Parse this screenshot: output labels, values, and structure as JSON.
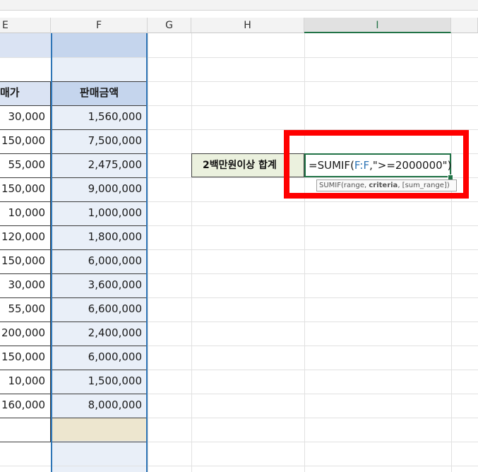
{
  "columns": [
    "E",
    "F",
    "G",
    "H",
    "I",
    "J"
  ],
  "headers": {
    "e": "매가",
    "f": "판매금액"
  },
  "rows": [
    {
      "e": "30,000",
      "f": "1,560,000"
    },
    {
      "e": "150,000",
      "f": "7,500,000"
    },
    {
      "e": "55,000",
      "f": "2,475,000"
    },
    {
      "e": "150,000",
      "f": "9,000,000"
    },
    {
      "e": "10,000",
      "f": "1,000,000"
    },
    {
      "e": "120,000",
      "f": "1,800,000"
    },
    {
      "e": "150,000",
      "f": "6,000,000"
    },
    {
      "e": "30,000",
      "f": "3,600,000"
    },
    {
      "e": "55,000",
      "f": "6,600,000"
    },
    {
      "e": "200,000",
      "f": "2,400,000"
    },
    {
      "e": "150,000",
      "f": "6,000,000"
    },
    {
      "e": "10,000",
      "f": "1,500,000"
    },
    {
      "e": "160,000",
      "f": "8,000,000"
    }
  ],
  "label_cell": "2백만원이상 합계",
  "formula": {
    "prefix": "=SUMIF(",
    "range_ref": "F:F",
    "suffix": ",\">=2000000\")"
  },
  "tooltip": {
    "fn": "SUMIF(range, ",
    "bold_arg": "criteria",
    "rest": ", [sum_range])"
  },
  "colors": {
    "header_band": "#dae3f3",
    "f_column_fill": "#e9eff8",
    "f_header_fill": "#c5d5ed",
    "label_fill": "#ebf1de",
    "total_fill": "#ede6cf",
    "highlight": "#ff0000",
    "selection": "#2e75b6",
    "active_border": "#217346"
  }
}
